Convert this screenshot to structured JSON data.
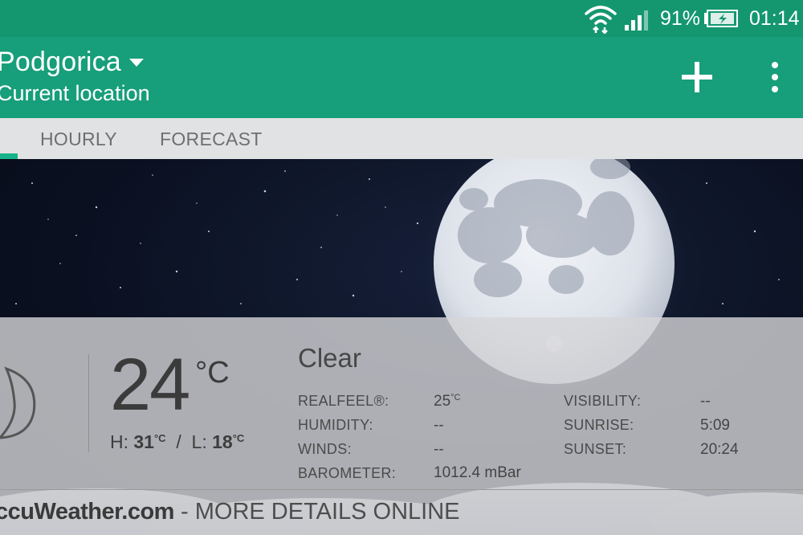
{
  "status_bar": {
    "battery": "91%",
    "time": "01:14",
    "icons": [
      "wifi-icon",
      "signal-icon",
      "battery-charging-icon"
    ]
  },
  "app_bar": {
    "city": "Podgorica",
    "subtitle": "Current location",
    "icons": [
      "dropdown-caret-icon",
      "add-icon",
      "more-vert-icon"
    ]
  },
  "tabs": [
    {
      "label": "HOURLY"
    },
    {
      "label": "FORECAST"
    }
  ],
  "current": {
    "temperature": "24",
    "unit": "°C",
    "high_label": "H:",
    "high": "31",
    "low_label": "L:",
    "low": "18",
    "deg_unit": "°C",
    "separator": "/",
    "condition": "Clear",
    "icon": "moon-icon"
  },
  "details": {
    "realfeel_label": "REALFEEL®:",
    "realfeel_value": "25",
    "humidity_label": "HUMIDITY:",
    "humidity_value": "--",
    "winds_label": "WINDS:",
    "winds_value": "--",
    "barometer_label": "BAROMETER:",
    "barometer_value": "1012.4 mBar",
    "visibility_label": "VISIBILITY:",
    "visibility_value": "--",
    "sunrise_label": "SUNRISE:",
    "sunrise_value": "5:09",
    "sunset_label": "SUNSET:",
    "sunset_value": "20:24"
  },
  "footer": {
    "brand": "ccuWeather.com",
    "text": " - MORE DETAILS ONLINE"
  },
  "colors": {
    "status_bar": "#14976f",
    "app_bar": "#179e7a",
    "tab_bar": "#e1e2e3",
    "tab_indicator": "#17b38a"
  }
}
